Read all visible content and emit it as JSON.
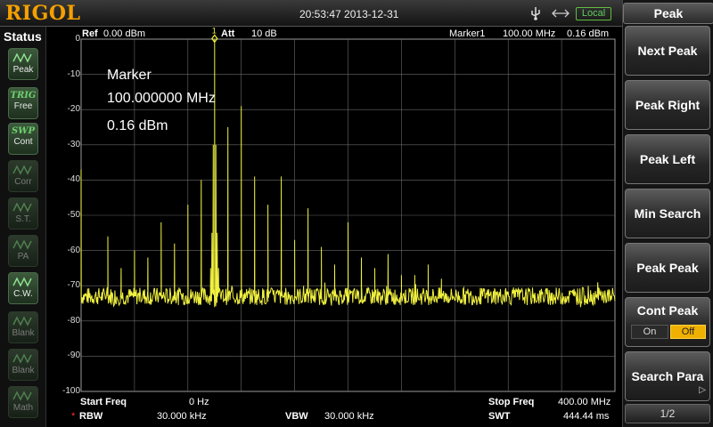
{
  "brand": "RIGOL",
  "datetime": "20:53:47 2013-12-31",
  "status_badge": "Local",
  "status_panel": {
    "title": "Status",
    "buttons": [
      {
        "top": "Peak",
        "bottom": "",
        "kind": "icon",
        "active": true
      },
      {
        "top": "TRIG",
        "bottom": "Free",
        "kind": "text",
        "active": true
      },
      {
        "top": "SWP",
        "bottom": "Cont",
        "kind": "text",
        "active": true
      },
      {
        "top": "Corr",
        "bottom": "",
        "kind": "icon",
        "active": false
      },
      {
        "top": "S.T.",
        "bottom": "",
        "kind": "icon",
        "active": false
      },
      {
        "top": "PA",
        "bottom": "",
        "kind": "icon",
        "active": false
      },
      {
        "top": "C.W.",
        "bottom": "",
        "kind": "icon",
        "active": true
      },
      {
        "top": "Blank",
        "bottom": "",
        "kind": "icon",
        "active": false
      },
      {
        "top": "Blank",
        "bottom": "",
        "kind": "icon",
        "active": false
      },
      {
        "top": "Math",
        "bottom": "",
        "kind": "icon",
        "active": false
      }
    ]
  },
  "header": {
    "ref_label": "Ref",
    "ref_value": "0.00 dBm",
    "att_label": "Att",
    "att_value": "10 dB",
    "marker_label": "Marker1",
    "marker_freq": "100.00 MHz",
    "marker_amp": "0.16 dBm"
  },
  "marker_readout": {
    "title": "Marker",
    "freq": "100.000000 MHz",
    "amp": "0.16 dBm"
  },
  "y_ticks": [
    "0",
    "-10",
    "-20",
    "-30",
    "-40",
    "-50",
    "-60",
    "-70",
    "-80",
    "-90",
    "-100"
  ],
  "footer": {
    "start_label": "Start Freq",
    "start_value": "0 Hz",
    "stop_label": "Stop Freq",
    "stop_value": "400.00 MHz",
    "rbw_label": "RBW",
    "rbw_value": "30.000 kHz",
    "vbw_label": "VBW",
    "vbw_value": "30.000 kHz",
    "swt_label": "SWT",
    "swt_value": "444.44 ms",
    "rbw_flag": "*"
  },
  "menu": {
    "title": "Peak",
    "keys": [
      "Next Peak",
      "Peak Right",
      "Peak Left",
      "Min Search",
      "Peak Peak",
      "Cont Peak",
      "Search Para"
    ],
    "cont_on": "On",
    "cont_off": "Off",
    "page": "1/2"
  },
  "colors": {
    "trace": "#f0f040",
    "brand": "#f5a000",
    "grid": "#6a6a6a",
    "toggle_active": "#f0b000"
  },
  "chart_data": {
    "type": "line",
    "xlabel": "",
    "ylabel": "",
    "x_unit": "MHz",
    "y_unit": "dBm",
    "xlim": [
      0,
      400
    ],
    "ylim": [
      -100,
      0
    ],
    "grid": true,
    "noise_floor": -73,
    "marker": {
      "x": 100.0,
      "y": 0.16
    },
    "peaks": [
      {
        "x": 0,
        "y": -37
      },
      {
        "x": 20,
        "y": -56
      },
      {
        "x": 30,
        "y": -65
      },
      {
        "x": 40,
        "y": -60
      },
      {
        "x": 50,
        "y": -62
      },
      {
        "x": 60,
        "y": -52
      },
      {
        "x": 70,
        "y": -58
      },
      {
        "x": 80,
        "y": -47
      },
      {
        "x": 90,
        "y": -40
      },
      {
        "x": 100,
        "y": 0.16
      },
      {
        "x": 110,
        "y": -25
      },
      {
        "x": 120,
        "y": -19
      },
      {
        "x": 130,
        "y": -39
      },
      {
        "x": 140,
        "y": -47
      },
      {
        "x": 150,
        "y": -39
      },
      {
        "x": 160,
        "y": -57
      },
      {
        "x": 170,
        "y": -48
      },
      {
        "x": 180,
        "y": -59
      },
      {
        "x": 190,
        "y": -64
      },
      {
        "x": 200,
        "y": -52
      },
      {
        "x": 210,
        "y": -62
      },
      {
        "x": 220,
        "y": -65
      },
      {
        "x": 230,
        "y": -61
      },
      {
        "x": 240,
        "y": -67
      },
      {
        "x": 250,
        "y": -67
      },
      {
        "x": 260,
        "y": -64
      },
      {
        "x": 270,
        "y": -68
      }
    ]
  }
}
